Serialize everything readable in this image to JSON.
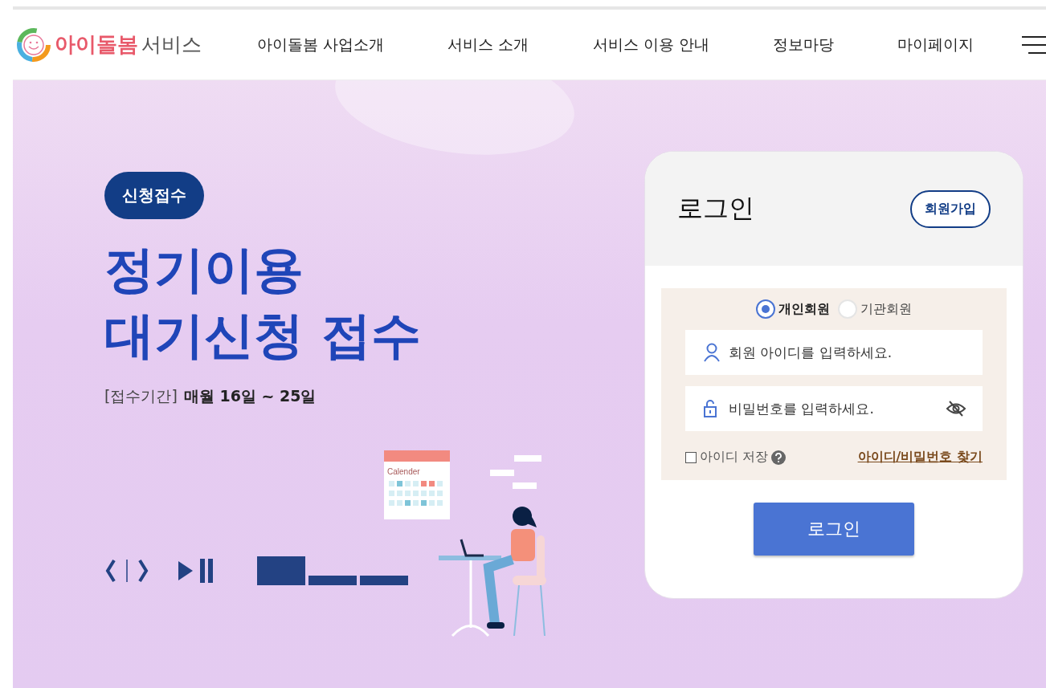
{
  "header": {
    "logo_brand": "아이돌봄",
    "logo_suffix": "서비스",
    "nav": [
      "아이돌봄 사업소개",
      "서비스 소개",
      "서비스 이용 안내",
      "정보마당",
      "마이페이지"
    ]
  },
  "banner": {
    "badge": "신청접수",
    "title_lines": [
      "정기이용",
      "대기신청 접수"
    ],
    "period_label": "[접수기간]",
    "period_value": "매월 16일 ~ 25일",
    "calendar_label": "Calender",
    "slides": [
      {
        "selected": true
      },
      {
        "selected": false
      },
      {
        "selected": false
      }
    ]
  },
  "login": {
    "title": "로그인",
    "signup": "회원가입",
    "member_types": [
      {
        "label": "개인회원",
        "selected": true
      },
      {
        "label": "기관회원",
        "selected": false
      }
    ],
    "id_placeholder": "회원 아이디를 입력하세요.",
    "password_placeholder": "비밀번호를 입력하세요.",
    "remember": {
      "label": "아이디 저장",
      "checked": false
    },
    "find_link": "아이디/비밀번호 찾기",
    "submit": "로그인"
  }
}
